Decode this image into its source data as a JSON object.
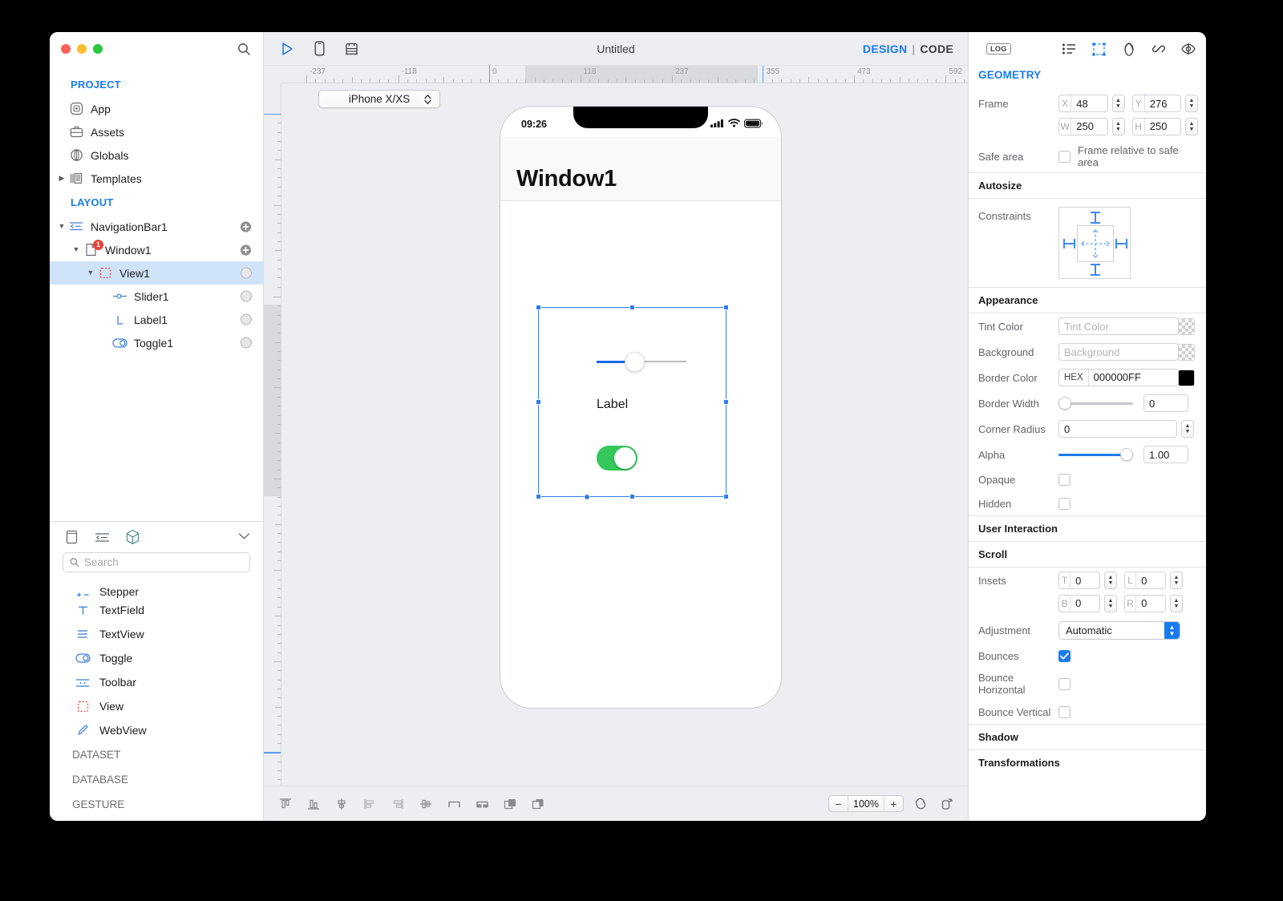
{
  "window": {
    "traffic": [
      "close",
      "minimize",
      "zoom"
    ]
  },
  "sidebar": {
    "search_icon": "search-icon",
    "project": {
      "title": "PROJECT",
      "items": [
        {
          "label": "App",
          "icon": "app-icon"
        },
        {
          "label": "Assets",
          "icon": "assets-icon"
        },
        {
          "label": "Globals",
          "icon": "globals-icon"
        },
        {
          "label": "Templates",
          "icon": "templates-icon"
        }
      ]
    },
    "layout": {
      "title": "LAYOUT",
      "items": [
        {
          "label": "NavigationBar1",
          "icon": "navigationbar-icon",
          "depth": 0,
          "expanded": true,
          "badge": "add",
          "selected": false
        },
        {
          "label": "Window1",
          "icon": "window-icon",
          "depth": 1,
          "expanded": true,
          "badge": "add",
          "count": "1",
          "selected": false
        },
        {
          "label": "View1",
          "icon": "view-icon",
          "depth": 2,
          "expanded": true,
          "badge": "knob",
          "selected": true
        },
        {
          "label": "Slider1",
          "icon": "slider-icon",
          "depth": 3,
          "expanded": false,
          "badge": "knob",
          "selected": false
        },
        {
          "label": "Label1",
          "icon": "label-icon",
          "depth": 3,
          "expanded": false,
          "badge": "knob",
          "selected": false
        },
        {
          "label": "Toggle1",
          "icon": "toggle-icon",
          "depth": 3,
          "expanded": false,
          "badge": "knob",
          "selected": false
        }
      ]
    }
  },
  "library": {
    "tabs": [
      "page-icon",
      "navigationbar-icon",
      "cube-icon"
    ],
    "collapse_icon": "chevron-down-icon",
    "search": {
      "placeholder": "Search",
      "value": ""
    },
    "items": [
      {
        "label": "Stepper",
        "icon": "stepper-icon"
      },
      {
        "label": "TextField",
        "icon": "textfield-icon"
      },
      {
        "label": "TextView",
        "icon": "textview-icon"
      },
      {
        "label": "Toggle",
        "icon": "toggle-icon"
      },
      {
        "label": "Toolbar",
        "icon": "toolbar-icon"
      },
      {
        "label": "View",
        "icon": "view-icon"
      },
      {
        "label": "WebView",
        "icon": "webview-icon"
      }
    ],
    "groups": [
      "DATASET",
      "DATABASE",
      "GESTURE"
    ]
  },
  "toolbar": {
    "run_icon": "play-icon",
    "device_icon": "device-icon",
    "layers_icon": "stack-icon",
    "title": "Untitled",
    "design_label": "DESIGN",
    "separator": "|",
    "code_label": "CODE"
  },
  "ruler": {
    "horizontal_labels": [
      "-237",
      "-118",
      "0",
      "118",
      "237",
      "355",
      "473",
      "592"
    ],
    "vertical_labels": [
      "0",
      "118",
      "237",
      "355",
      "473",
      "592",
      "710",
      "828"
    ]
  },
  "canvas": {
    "device_selector": {
      "value": "iPhone X/XS"
    },
    "phone": {
      "status_time": "09:26",
      "status_icons": [
        "cellular-icon",
        "wifi-icon",
        "battery-icon"
      ],
      "navbar_title": "Window1",
      "label_text": "Label",
      "toggle_on": true,
      "slider_value": 0.5
    }
  },
  "bottom_toolbar": {
    "align_buttons": [
      "align-top-icon",
      "align-bottom-icon",
      "align-vertical-center-icon",
      "align-left-icon",
      "align-right-icon",
      "align-horizontal-center-icon",
      "distribute-icon",
      "distribute-two-icon",
      "bring-forward-icon",
      "send-backward-icon"
    ],
    "zoom": {
      "minus": "−",
      "value": "100%",
      "plus": "+"
    },
    "extra_icons": [
      "magnifier-icon",
      "duplicate-icon"
    ]
  },
  "inspector": {
    "log_label": "LOG",
    "icons": [
      "list-icon",
      "geometry-icon",
      "appearance-icon",
      "link-icon",
      "preview-icon"
    ],
    "geometry_title": "GEOMETRY",
    "frame": {
      "label": "Frame",
      "x": {
        "prefix": "X",
        "value": "48"
      },
      "y": {
        "prefix": "Y",
        "value": "276"
      },
      "w": {
        "prefix": "W",
        "value": "250"
      },
      "h": {
        "prefix": "H",
        "value": "250"
      }
    },
    "safe_area": {
      "label": "Safe area",
      "checkbox_label": "Frame relative to safe area",
      "checked": false
    },
    "autosize": {
      "title": "Autosize",
      "constraints_label": "Constraints"
    },
    "appearance": {
      "title": "Appearance",
      "tint_color": {
        "label": "Tint Color",
        "placeholder": "Tint Color",
        "value": ""
      },
      "background": {
        "label": "Background",
        "placeholder": "Background",
        "value": ""
      },
      "border_color": {
        "label": "Border Color",
        "prefix": "HEX",
        "value": "000000FF",
        "swatch": "#000000"
      },
      "border_width": {
        "label": "Border Width",
        "value": "0",
        "fill": 0
      },
      "corner_radius": {
        "label": "Corner Radius",
        "value": "0"
      },
      "alpha": {
        "label": "Alpha",
        "value": "1.00",
        "fill": 100
      },
      "opaque": {
        "label": "Opaque",
        "checked": false
      },
      "hidden": {
        "label": "Hidden",
        "checked": false
      }
    },
    "user_interaction": {
      "title": "User Interaction"
    },
    "scroll": {
      "title": "Scroll",
      "insets": {
        "label": "Insets",
        "t": {
          "prefix": "T",
          "value": "0"
        },
        "l": {
          "prefix": "L",
          "value": "0"
        },
        "b": {
          "prefix": "B",
          "value": "0"
        },
        "r": {
          "prefix": "R",
          "value": "0"
        }
      },
      "adjustment": {
        "label": "Adjustment",
        "value": "Automatic"
      },
      "bounces": {
        "label": "Bounces",
        "checked": true
      },
      "bounce_horizontal": {
        "label": "Bounce Horizontal",
        "checked": false
      },
      "bounce_vertical": {
        "label": "Bounce Vertical",
        "checked": false
      }
    },
    "shadow": {
      "title": "Shadow"
    },
    "transformations": {
      "title": "Transformations"
    }
  }
}
